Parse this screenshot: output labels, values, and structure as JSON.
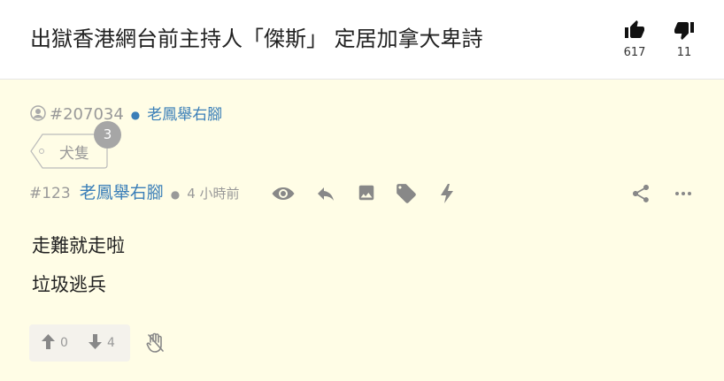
{
  "header": {
    "title": "出獄香港網台前主持人「傑斯」 定居加拿大卑詩",
    "like_count": "617",
    "dislike_count": "11"
  },
  "thread": {
    "post_id": "#207034",
    "author": "老鳳舉右腳",
    "tag_label": "犬隻",
    "tag_count": "3"
  },
  "reply": {
    "number": "#123",
    "author": "老鳳舉右腳",
    "time": "4 小時前",
    "lines": [
      "走難就走啦",
      "垃圾逃兵"
    ],
    "upvotes": "0",
    "downvotes": "4"
  },
  "colors": {
    "background": "#fffde6",
    "link": "#3b7fb8",
    "muted": "#999999",
    "icon": "#888888"
  },
  "icons": [
    "thumbs-up-icon",
    "thumbs-down-icon",
    "user-icon",
    "eye-icon",
    "reply-icon",
    "image-icon",
    "tag-icon",
    "lightning-icon",
    "share-icon",
    "more-icon",
    "arrow-up-icon",
    "arrow-down-icon",
    "hand-icon"
  ]
}
